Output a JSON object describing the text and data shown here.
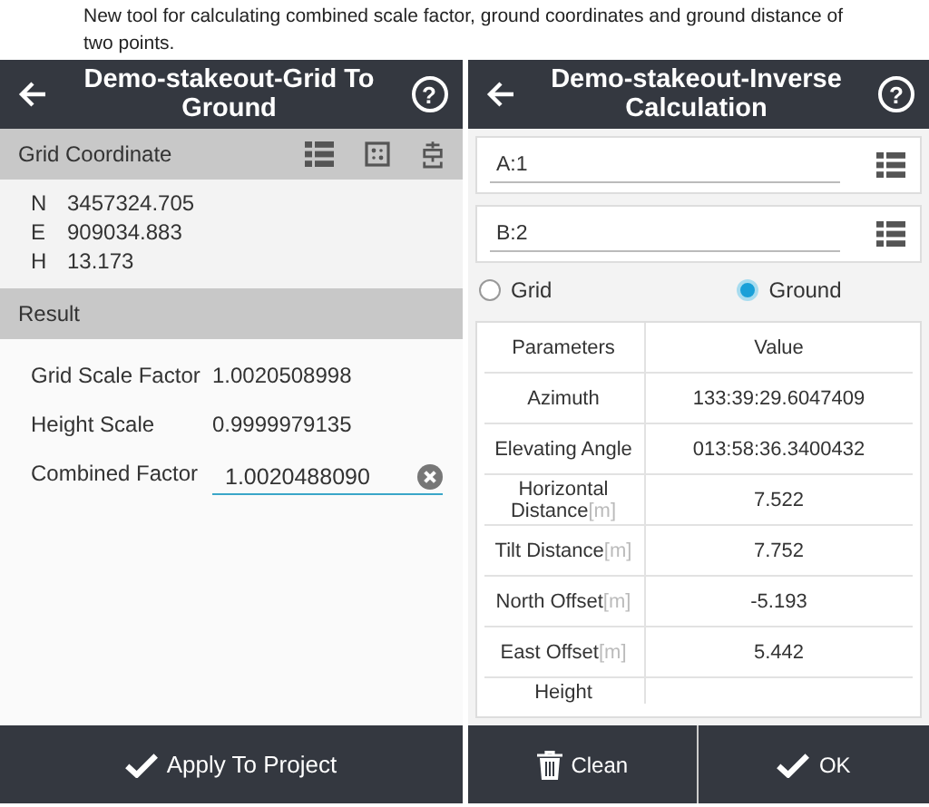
{
  "caption": "New tool for calculating combined scale factor, ground coordinates and ground distance of two points.",
  "left": {
    "title": "Demo-stakeout-Grid To Ground",
    "help": "?",
    "grid_section": {
      "label": "Grid Coordinate"
    },
    "coords": [
      {
        "axis": "N",
        "value": "3457324.705"
      },
      {
        "axis": "E",
        "value": "909034.883"
      },
      {
        "axis": "H",
        "value": "13.173"
      }
    ],
    "result_section": {
      "label": "Result"
    },
    "results": [
      {
        "kind": "text",
        "label": "Grid Scale Factor",
        "value": "1.0020508998"
      },
      {
        "kind": "text",
        "label": "Height Scale",
        "value": "0.9999979135"
      },
      {
        "kind": "field",
        "label": "Combined Factor",
        "value": "1.0020488090"
      }
    ],
    "apply_button": {
      "label": "Apply To Project"
    }
  },
  "right": {
    "title": "Demo-stakeout-Inverse Calculation",
    "help": "?",
    "point_fields": [
      {
        "value": "A:1"
      },
      {
        "value": "B:2"
      }
    ],
    "radios": [
      {
        "label": "Grid",
        "selected": false
      },
      {
        "label": "Ground",
        "selected": true
      }
    ],
    "table": {
      "columns": [
        "Parameters",
        "Value"
      ],
      "rows": [
        {
          "parameter": "Azimuth",
          "value": "133:39:29.6047409"
        },
        {
          "parameter": "Elevating Angle",
          "value": "013:58:36.3400432"
        },
        {
          "parameter": "Horizontal Distance",
          "unit": "[m]",
          "value": "7.522"
        },
        {
          "parameter": "Tilt Distance",
          "unit": "[m]",
          "value": "7.752"
        },
        {
          "parameter": "North Offset",
          "unit": "[m]",
          "value": "-5.193"
        },
        {
          "parameter": "East Offset",
          "unit": "[m]",
          "value": "5.442"
        },
        {
          "parameter": "Height"
        }
      ]
    }
  },
  "buttons": [
    {
      "kind": "clean",
      "label": "Clean"
    },
    {
      "kind": "ok",
      "label": "OK"
    }
  ]
}
